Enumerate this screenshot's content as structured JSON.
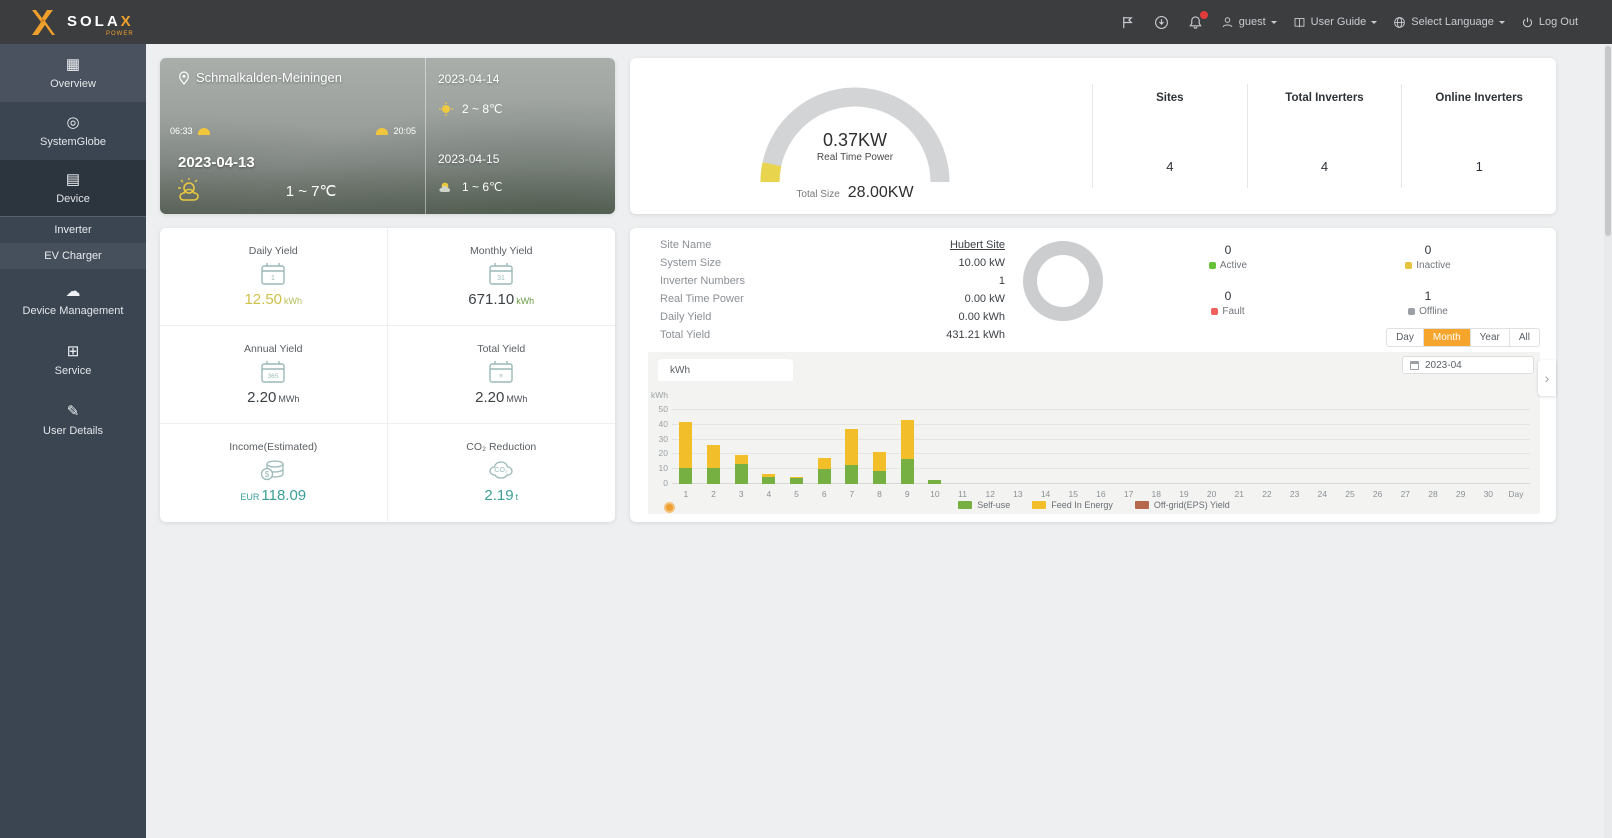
{
  "topbar": {
    "brand": "SOLA",
    "brand_x": "X",
    "brand_sub": "POWER",
    "user": "guest",
    "user_guide": "User Guide",
    "language": "Select Language",
    "logout": "Log Out"
  },
  "sidebar": {
    "items": [
      {
        "label": "Overview",
        "icon": "overview-icon"
      },
      {
        "label": "SystemGlobe",
        "icon": "system-globe-icon"
      },
      {
        "label": "Device",
        "icon": "device-icon"
      },
      {
        "label": "Device Management",
        "icon": "device-management-icon"
      },
      {
        "label": "Service",
        "icon": "service-icon"
      },
      {
        "label": "User Details",
        "icon": "user-details-icon"
      }
    ],
    "submenu": [
      {
        "label": "Inverter"
      },
      {
        "label": "EV Charger"
      }
    ]
  },
  "weather": {
    "location": "Schmalkalden-Meiningen",
    "sunrise": "06:33",
    "sunset": "20:05",
    "today": {
      "date": "2023-04-13",
      "temp": "1 ~ 7℃"
    },
    "forecast": [
      {
        "date": "2023-04-14",
        "temp": "2 ~ 8℃"
      },
      {
        "date": "2023-04-15",
        "temp": "1 ~ 6℃"
      }
    ]
  },
  "power": {
    "value": "0.37KW",
    "label": "Real Time Power",
    "total_label": "Total Size",
    "total_value": "28.00KW",
    "stats": [
      {
        "label": "Sites",
        "value": "4"
      },
      {
        "label": "Total Inverters",
        "value": "4"
      },
      {
        "label": "Online Inverters",
        "value": "1"
      }
    ]
  },
  "yields": {
    "items": [
      {
        "label": "Daily Yield",
        "value": "12.50",
        "unit": "kWh",
        "icon": "calendar-day-icon"
      },
      {
        "label": "Monthly Yield",
        "value": "671.10",
        "unit": "kWh",
        "icon": "calendar-month-icon"
      },
      {
        "label": "Annual Yield",
        "value": "2.20",
        "unit": "MWh",
        "icon": "calendar-year-icon"
      },
      {
        "label": "Total Yield",
        "value": "2.20",
        "unit": "MWh",
        "icon": "calendar-total-icon"
      },
      {
        "label": "Income(Estimated)",
        "value": "118.09",
        "prefix": "EUR",
        "unit": "",
        "icon": "income-icon"
      },
      {
        "label": "CO₂ Reduction",
        "value": "2.19",
        "unit": "t",
        "icon": "co2-icon"
      }
    ]
  },
  "site": {
    "rows": [
      {
        "label": "Site Name",
        "value": "Hubert Site"
      },
      {
        "label": "System Size",
        "value": "10.00 kW"
      },
      {
        "label": "Inverter Numbers",
        "value": "1"
      },
      {
        "label": "Real Time Power",
        "value": "0.00 kW"
      },
      {
        "label": "Daily Yield",
        "value": "0.00 kWh"
      },
      {
        "label": "Total Yield",
        "value": "431.21 kWh"
      }
    ],
    "statuses": [
      {
        "label": "Active",
        "value": "0",
        "color": "#67c23a"
      },
      {
        "label": "Inactive",
        "value": "0",
        "color": "#e6c33c"
      },
      {
        "label": "Fault",
        "value": "0",
        "color": "#f25f5f"
      },
      {
        "label": "Offline",
        "value": "1",
        "color": "#9aa0a6"
      }
    ],
    "range_tabs": [
      {
        "label": "Day"
      },
      {
        "label": "Month",
        "active": true
      },
      {
        "label": "Year"
      },
      {
        "label": "All"
      }
    ],
    "date": "2023-04",
    "unit_tab": "kWh"
  },
  "chart_data": {
    "type": "bar",
    "stacked": true,
    "unit": "kWh",
    "xlabel": "Day",
    "ylabel": "kWh",
    "ylim": [
      0,
      50
    ],
    "yticks": [
      0,
      10,
      20,
      30,
      40,
      50
    ],
    "grid": true,
    "legend_position": "bottom",
    "categories": [
      1,
      2,
      3,
      4,
      5,
      6,
      7,
      8,
      9,
      10,
      11,
      12,
      13,
      14,
      15,
      16,
      17,
      18,
      19,
      20,
      21,
      22,
      23,
      24,
      25,
      26,
      27,
      28,
      29,
      30
    ],
    "series": [
      {
        "name": "Self-use",
        "color": "#76b043",
        "values": [
          11,
          10.5,
          13.5,
          5,
          4,
          10,
          13,
          9,
          17,
          3,
          0,
          0,
          0,
          0,
          0,
          0,
          0,
          0,
          0,
          0,
          0,
          0,
          0,
          0,
          0,
          0,
          0,
          0,
          0,
          0
        ]
      },
      {
        "name": "Feed In Energy",
        "color": "#f2bf2b",
        "values": [
          31,
          16,
          6,
          2,
          1,
          7.5,
          24,
          12.5,
          26.5,
          0,
          0,
          0,
          0,
          0,
          0,
          0,
          0,
          0,
          0,
          0,
          0,
          0,
          0,
          0,
          0,
          0,
          0,
          0,
          0,
          0
        ]
      },
      {
        "name": "Off-grid(EPS) Yield",
        "color": "#b5694d",
        "values": [
          0,
          0,
          0,
          0,
          0,
          0,
          0,
          0,
          0,
          0,
          0,
          0,
          0,
          0,
          0,
          0,
          0,
          0,
          0,
          0,
          0,
          0,
          0,
          0,
          0,
          0,
          0,
          0,
          0,
          0
        ]
      }
    ]
  },
  "theme": {
    "accent_orange": "#f5a52c",
    "topbar_bg": "#3c3d3f",
    "sidebar_bg": "#3b4552",
    "daily_yellow": "#cfc04a",
    "income_teal": "#3a9e96",
    "gauge_gray": "#d3d4d6",
    "gauge_tip_yellow": "#e8d44d",
    "donut_gray": "#cbcdcf"
  }
}
